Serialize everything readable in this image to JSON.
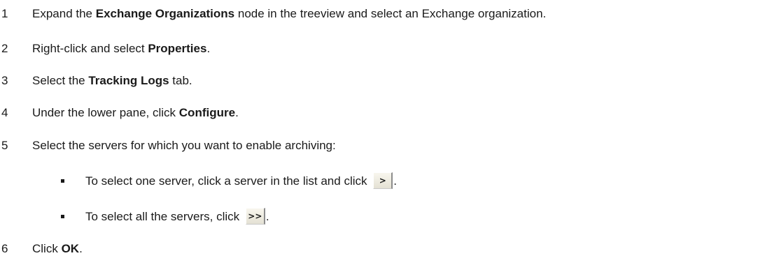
{
  "steps": [
    {
      "num": "1",
      "pre": "Expand the ",
      "bold": "Exchange Organizations",
      "post": " node in the treeview and select an Exchange organization."
    },
    {
      "num": "2",
      "pre": "Right-click and select ",
      "bold": "Properties",
      "post": "."
    },
    {
      "num": "3",
      "pre": "Select the ",
      "bold": "Tracking Logs",
      "post": " tab."
    },
    {
      "num": "4",
      "pre": "Under the lower pane, click ",
      "bold": "Configure",
      "post": "."
    },
    {
      "num": "5",
      "text": "Select the servers for which you want to enable archiving:"
    },
    {
      "num": "6",
      "pre": "Click ",
      "bold": "OK",
      "post": "."
    }
  ],
  "substeps": [
    {
      "text": "To select one server, click a server in the list and click ",
      "button": ">",
      "post": "."
    },
    {
      "text": "To select all the servers, click ",
      "button": ">>",
      "post": "."
    }
  ]
}
